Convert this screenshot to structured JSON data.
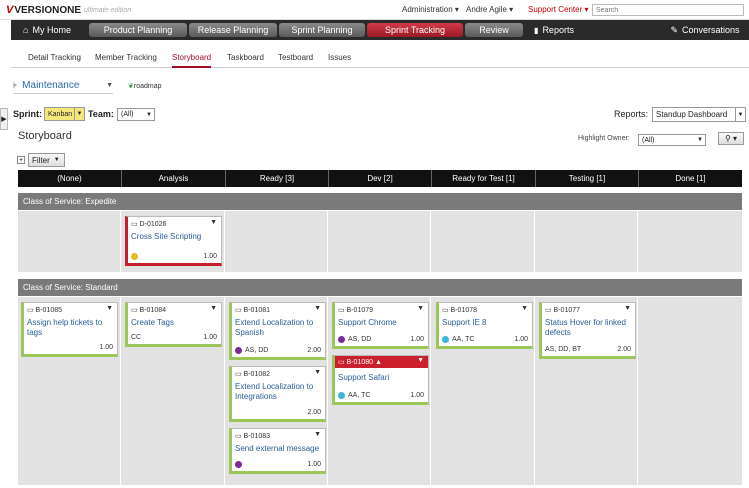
{
  "top": {
    "logo_main": "VERSIONONE",
    "logo_edition": "ultimate edition",
    "admin": "Administration ▾",
    "user": "Andre Agile ▾",
    "support": "Support Center ▾",
    "search_placeholder": "Search"
  },
  "nav": {
    "home": "My Home",
    "items": [
      "Product Planning",
      "Release Planning",
      "Sprint Planning",
      "Sprint Tracking",
      "Review"
    ],
    "reports": "Reports",
    "conversations": "Conversations"
  },
  "subtabs": [
    "Detail Tracking",
    "Member Tracking",
    "Storyboard",
    "Taskboard",
    "Testboard",
    "Issues"
  ],
  "project": {
    "name": "Maintenance",
    "roadmap": "roadmap"
  },
  "filters": {
    "sprint_label": "Sprint:",
    "sprint_value": "Kanban",
    "team_label": "Team:",
    "team_value": "(All)",
    "reports_label": "Reports:",
    "reports_value": "Standup Dashboard",
    "highlight_label": "Highlight Owner:",
    "highlight_value": "(All)",
    "filter_label": "Filter"
  },
  "board": {
    "title": "Storyboard",
    "columns": [
      "(None)",
      "Analysis",
      "Ready [3]",
      "Dev [2]",
      "Ready for Test [1]",
      "Testing [1]",
      "Done [1]"
    ]
  },
  "lanes": {
    "expedite": "Class of Service: Expedite",
    "standard": "Class of Service: Standard"
  },
  "cards": [
    {
      "id": "D-01026",
      "title": "Cross Site Scripting",
      "owners": "",
      "est": "1.00",
      "color": "#e8b820"
    },
    {
      "id": "B-01085",
      "title": "Assign help tickets to tags",
      "owners": "",
      "est": "1.00",
      "color": ""
    },
    {
      "id": "B-01084",
      "title": "Create Tags",
      "owners": "CC",
      "est": "1.00",
      "color": ""
    },
    {
      "id": "B-01081",
      "title": "Extend Localization to Spanish",
      "owners": "AS, DD",
      "est": "2.00",
      "color": "#7a2a9a"
    },
    {
      "id": "B-01082",
      "title": "Extend Localization to Integrations",
      "owners": "",
      "est": "2.00",
      "color": ""
    },
    {
      "id": "B-01083",
      "title": "Send external message",
      "owners": "",
      "est": "1.00",
      "color": "#7a2a9a"
    },
    {
      "id": "B-01079",
      "title": "Support Chrome",
      "owners": "AS, DD",
      "est": "1.00",
      "color": "#7a2a9a"
    },
    {
      "id": "B-01080 ▲",
      "title": "Support Safari",
      "owners": "AA, TC",
      "est": "1.00",
      "color": "#35b8d8"
    },
    {
      "id": "B-01078",
      "title": "Support IE 8",
      "owners": "AA, TC",
      "est": "1.00",
      "color": "#35b8d8"
    },
    {
      "id": "B-01077",
      "title": "Status Hover for linked defects",
      "owners": "AS, DD, BT",
      "est": "2.00",
      "color": ""
    }
  ]
}
